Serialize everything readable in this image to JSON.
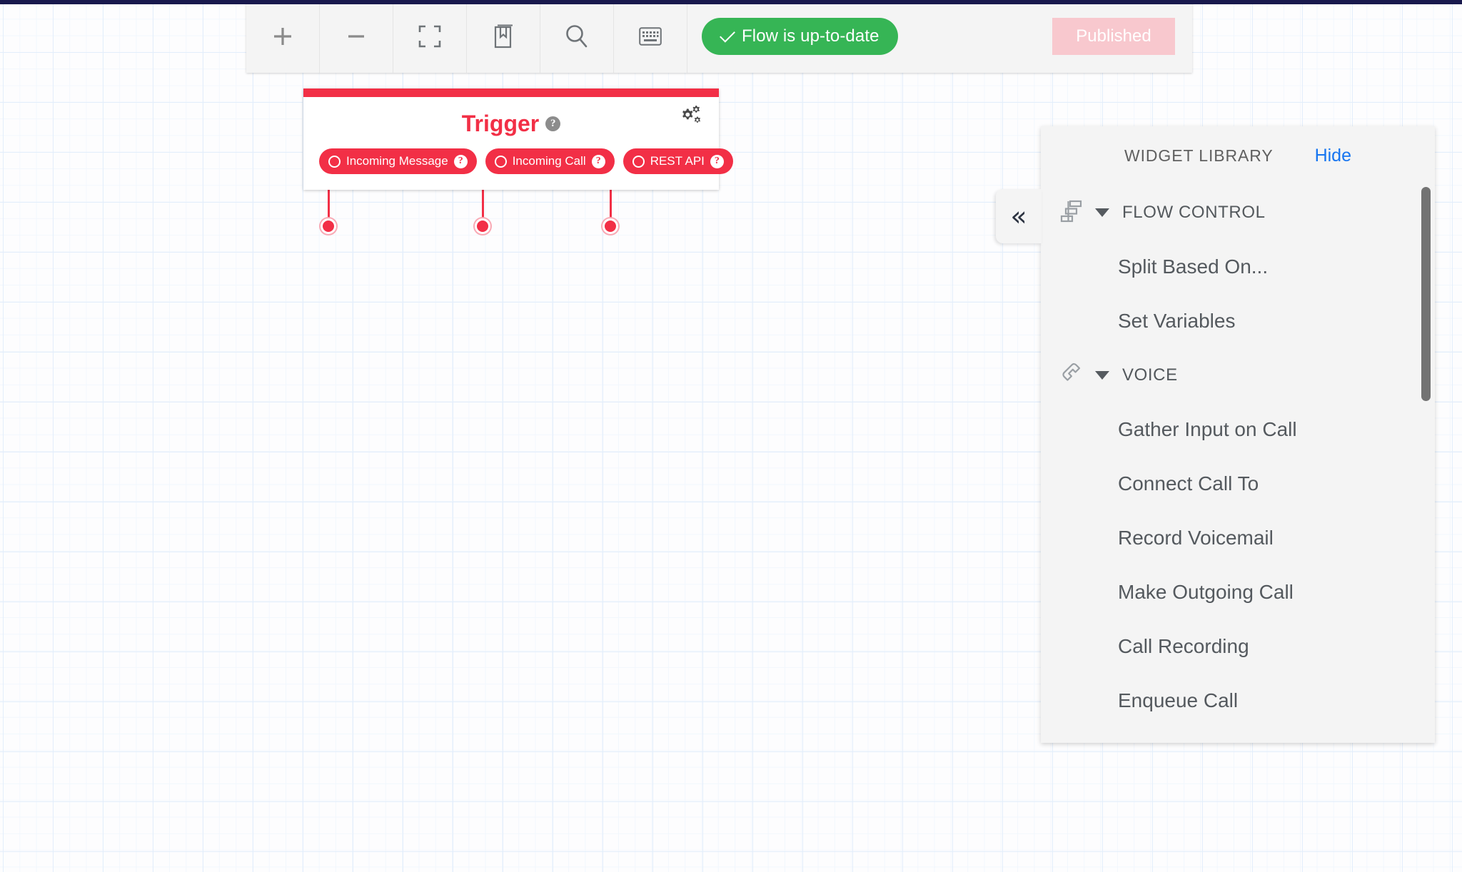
{
  "colors": {
    "brand_red": "#f22f46",
    "status_green": "#36b555",
    "published_pink": "#f8c8ce",
    "link_blue": "#1775f0",
    "top_band_navy": "#19194d",
    "panel_gray": "#f4f4f4",
    "grid_blue": "#e3eefb"
  },
  "toolbar": {
    "buttons": [
      {
        "icon": "plus-icon",
        "name": "zoom-in-button"
      },
      {
        "icon": "minus-icon",
        "name": "zoom-out-button"
      },
      {
        "icon": "fit-to-screen-icon",
        "name": "fit-to-screen-button"
      },
      {
        "icon": "documentation-book-icon",
        "name": "documentation-button"
      },
      {
        "icon": "search-icon",
        "name": "search-button"
      },
      {
        "icon": "keyboard-icon",
        "name": "keyboard-shortcuts-button"
      }
    ],
    "flow_status_label": "Flow is up-to-date",
    "flow_status_icon": "check-icon",
    "publish_label": "Published"
  },
  "trigger": {
    "title": "Trigger",
    "help_icon": "help-circle-icon",
    "settings_icon": "gears-icon",
    "pills": [
      {
        "label": "Incoming Message",
        "help_icon": "help-circle-icon"
      },
      {
        "label": "Incoming Call",
        "help_icon": "help-circle-icon"
      },
      {
        "label": "REST API",
        "help_icon": "help-circle-icon"
      }
    ]
  },
  "widget_library": {
    "title": "WIDGET LIBRARY",
    "hide_label": "Hide",
    "collapse_icon": "double-chevron-left-icon",
    "groups": [
      {
        "label": "FLOW CONTROL",
        "icon": "flow-control-split-icon",
        "expanded": true,
        "items": [
          "Split Based On...",
          "Set Variables"
        ]
      },
      {
        "label": "VOICE",
        "icon": "phone-handset-icon",
        "expanded": true,
        "items": [
          "Gather Input on Call",
          "Connect Call To",
          "Record Voicemail",
          "Make Outgoing Call",
          "Call Recording",
          "Enqueue Call"
        ]
      }
    ]
  }
}
